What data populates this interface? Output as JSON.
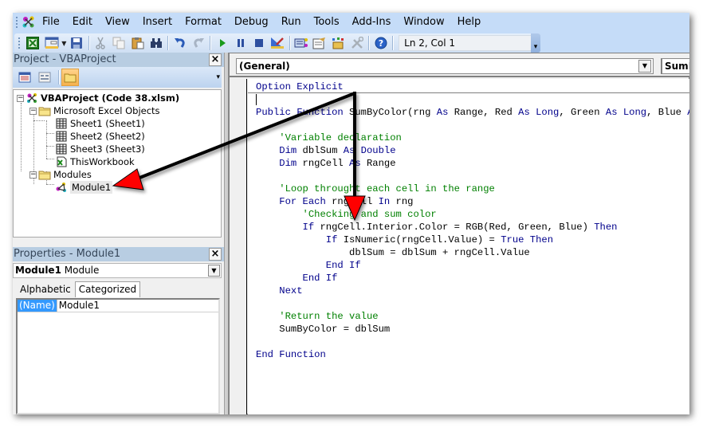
{
  "menubar": {
    "items": [
      "File",
      "Edit",
      "View",
      "Insert",
      "Format",
      "Debug",
      "Run",
      "Tools",
      "Add-Ins",
      "Window",
      "Help"
    ],
    "app_icon": "vba-editor-icon"
  },
  "toolbar": {
    "buttons": [
      {
        "name": "view-excel-icon"
      },
      {
        "name": "insert-userform-icon",
        "has_dropdown": true
      },
      {
        "name": "save-icon"
      },
      {
        "name": "cut-icon"
      },
      {
        "name": "copy-icon"
      },
      {
        "name": "paste-icon"
      },
      {
        "name": "find-icon"
      },
      {
        "name": "undo-icon"
      },
      {
        "name": "redo-icon"
      },
      {
        "name": "run-icon"
      },
      {
        "name": "break-icon"
      },
      {
        "name": "reset-icon"
      },
      {
        "name": "design-mode-icon"
      },
      {
        "name": "project-explorer-icon"
      },
      {
        "name": "properties-window-icon"
      },
      {
        "name": "object-browser-icon"
      },
      {
        "name": "toolbox-icon"
      },
      {
        "name": "help-icon"
      }
    ],
    "status": "Ln 2, Col 1"
  },
  "project_pane": {
    "title": "Project - VBAProject",
    "close_label": "×",
    "tree": [
      {
        "label": "VBAProject (Code 38.xlsm)",
        "level": 0,
        "icon": "vba-project-icon",
        "expander": "−",
        "bold": true
      },
      {
        "label": "Microsoft Excel Objects",
        "level": 1,
        "icon": "folder-icon",
        "expander": "−"
      },
      {
        "label": "Sheet1 (Sheet1)",
        "level": 2,
        "icon": "worksheet-icon"
      },
      {
        "label": "Sheet2 (Sheet2)",
        "level": 2,
        "icon": "worksheet-icon"
      },
      {
        "label": "Sheet3 (Sheet3)",
        "level": 2,
        "icon": "worksheet-icon"
      },
      {
        "label": "ThisWorkbook",
        "level": 2,
        "icon": "workbook-icon"
      },
      {
        "label": "Modules",
        "level": 1,
        "icon": "folder-icon",
        "expander": "−"
      },
      {
        "label": "Module1",
        "level": 2,
        "icon": "module-icon",
        "selected": true
      }
    ]
  },
  "properties_pane": {
    "title": "Properties - Module1",
    "close_label": "×",
    "object_name": "Module1",
    "object_type": "Module",
    "tabs": [
      "Alphabetic",
      "Categorized"
    ],
    "active_tab": "Alphabetic",
    "rows": [
      {
        "name": "(Name)",
        "value": "Module1"
      }
    ]
  },
  "code_window": {
    "object_combo": "(General)",
    "procedure_combo": "SumByColor",
    "colors": {
      "keyword": "#00008b",
      "comment": "#008000",
      "text": "#000000"
    },
    "lines": [
      [
        {
          "t": "Option Explicit",
          "k": "kw"
        }
      ],
      [
        {
          "t": "",
          "k": "caret"
        }
      ],
      [
        {
          "t": "Public Function ",
          "k": "kw"
        },
        {
          "t": "SumByColor(rng ",
          "k": "tx"
        },
        {
          "t": "As ",
          "k": "kw"
        },
        {
          "t": "Range, Red ",
          "k": "tx"
        },
        {
          "t": "As Long",
          "k": "kw"
        },
        {
          "t": ", Green ",
          "k": "tx"
        },
        {
          "t": "As Long",
          "k": "kw"
        },
        {
          "t": ", Blue ",
          "k": "tx"
        },
        {
          "t": "As Long",
          "k": "kw"
        },
        {
          "t": ")",
          "k": "tx"
        }
      ],
      [],
      [
        {
          "t": "    'Variable declaration",
          "k": "cm"
        }
      ],
      [
        {
          "t": "    Dim ",
          "k": "kw"
        },
        {
          "t": "dblSum ",
          "k": "tx"
        },
        {
          "t": "As Double",
          "k": "kw"
        }
      ],
      [
        {
          "t": "    Dim ",
          "k": "kw"
        },
        {
          "t": "rngCell ",
          "k": "tx"
        },
        {
          "t": "As ",
          "k": "kw"
        },
        {
          "t": "Range",
          "k": "tx"
        }
      ],
      [],
      [
        {
          "t": "    'Loop throught each cell in the range",
          "k": "cm"
        }
      ],
      [
        {
          "t": "    For Each ",
          "k": "kw"
        },
        {
          "t": "rngCell ",
          "k": "tx"
        },
        {
          "t": "In ",
          "k": "kw"
        },
        {
          "t": "rng",
          "k": "tx"
        }
      ],
      [
        {
          "t": "        'Checking and sum color",
          "k": "cm"
        }
      ],
      [
        {
          "t": "        If ",
          "k": "kw"
        },
        {
          "t": "rngCell.Interior.Color = RGB(Red, Green, Blue) ",
          "k": "tx"
        },
        {
          "t": "Then",
          "k": "kw"
        }
      ],
      [
        {
          "t": "            If ",
          "k": "kw"
        },
        {
          "t": "IsNumeric(rngCell.Value) = ",
          "k": "tx"
        },
        {
          "t": "True Then",
          "k": "kw"
        }
      ],
      [
        {
          "t": "                dblSum = dblSum + rngCell.Value",
          "k": "tx"
        }
      ],
      [
        {
          "t": "            End If",
          "k": "kw"
        }
      ],
      [
        {
          "t": "        End If",
          "k": "kw"
        }
      ],
      [
        {
          "t": "    Next",
          "k": "kw"
        }
      ],
      [],
      [
        {
          "t": "    'Return the value",
          "k": "cm"
        }
      ],
      [
        {
          "t": "    SumByColor = dblSum",
          "k": "tx"
        }
      ],
      [],
      [
        {
          "t": "End Function",
          "k": "kw"
        }
      ]
    ]
  },
  "annotations": {
    "arrow_color": "#000000",
    "arrowhead_color": "#ff0000",
    "arrows": [
      {
        "from": "option-explicit-line",
        "to": "module1-tree-item"
      },
      {
        "from": "option-explicit-line",
        "to": "code-body"
      }
    ]
  }
}
